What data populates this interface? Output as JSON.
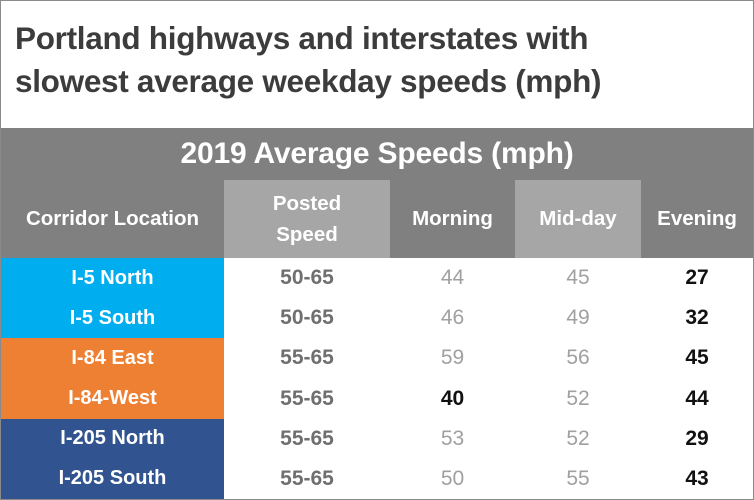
{
  "title": {
    "line1": "Portland highways and interstates with",
    "line2": "slowest average weekday speeds (mph)"
  },
  "table": {
    "subtitle": "2019 Average Speeds (mph)",
    "columns": [
      {
        "key": "corridor",
        "label": "Corridor Location",
        "highlight": false
      },
      {
        "key": "posted",
        "label_line1": "Posted",
        "label_line2": "Speed",
        "highlight": true
      },
      {
        "key": "morning",
        "label": "Morning",
        "highlight": false
      },
      {
        "key": "midday",
        "label": "Mid-day",
        "highlight": true
      },
      {
        "key": "evening",
        "label": "Evening",
        "highlight": false
      }
    ],
    "rows": [
      {
        "corridor": "I-5 North",
        "posted": "50-65",
        "morning": "44",
        "midday": "45",
        "evening": "27"
      },
      {
        "corridor": "I-5 South",
        "posted": "50-65",
        "morning": "46",
        "midday": "49",
        "evening": "32"
      },
      {
        "corridor": "I-84 East",
        "posted": "55-65",
        "morning": "59",
        "midday": "56",
        "evening": "45"
      },
      {
        "corridor": "I-84-West",
        "posted": "55-65",
        "morning": "40",
        "midday": "52",
        "evening": "44"
      },
      {
        "corridor": "I-205 North",
        "posted": "55-65",
        "morning": "53",
        "midday": "52",
        "evening": "29"
      },
      {
        "corridor": "I-205 South",
        "posted": "55-65",
        "morning": "50",
        "midday": "55",
        "evening": "43"
      }
    ]
  },
  "chart_data": {
    "type": "table",
    "title": "Portland highways and interstates with slowest average weekday speeds (mph)",
    "subtitle": "2019 Average Speeds (mph)",
    "columns": [
      "Corridor Location",
      "Posted Speed",
      "Morning",
      "Mid-day",
      "Evening"
    ],
    "rows": [
      [
        "I-5 North",
        "50-65",
        44,
        45,
        27
      ],
      [
        "I-5 South",
        "50-65",
        46,
        49,
        32
      ],
      [
        "I-84 East",
        "55-65",
        59,
        56,
        45
      ],
      [
        "I-84-West",
        "55-65",
        40,
        52,
        44
      ],
      [
        "I-205 North",
        "55-65",
        53,
        52,
        29
      ],
      [
        "I-205 South",
        "55-65",
        50,
        55,
        43
      ]
    ],
    "emphasized_cells": [
      {
        "row": "I-5 North",
        "column": "Evening",
        "value": 27
      },
      {
        "row": "I-5 South",
        "column": "Evening",
        "value": 32
      },
      {
        "row": "I-84 East",
        "column": "Evening",
        "value": 45
      },
      {
        "row": "I-84-West",
        "column": "Morning",
        "value": 40
      },
      {
        "row": "I-84-West",
        "column": "Evening",
        "value": 44
      },
      {
        "row": "I-205 North",
        "column": "Evening",
        "value": 29
      },
      {
        "row": "I-205 South",
        "column": "Evening",
        "value": 43
      }
    ],
    "row_group_colors": {
      "I-5": "#00AEEF",
      "I-84": "#ED8033",
      "I-205": "#31538F"
    },
    "header_colors": {
      "base": "#808080",
      "highlight": "#A6A6A6"
    },
    "ylabel": "",
    "xlabel": "",
    "units": "mph"
  }
}
